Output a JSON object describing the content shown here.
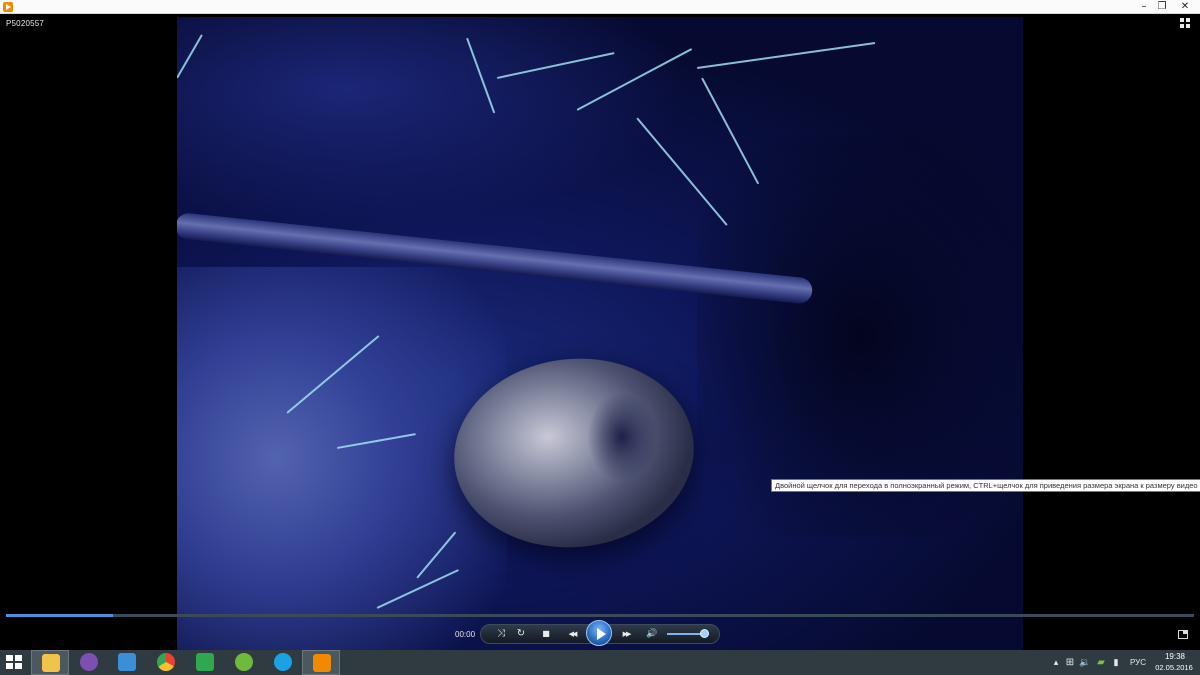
{
  "window": {
    "title_icon": "media-player-icon",
    "minimize": "–",
    "maximize": "❐",
    "close": "✕"
  },
  "file_title": "P5020557",
  "tooltip": "Двойной щелчок для перехода в полноэкранный режим, CTRL+щелчок для приведения размера экрана к размеру видео",
  "playback": {
    "time": "00:00",
    "progress_fraction": 0.09,
    "volume_fraction": 0.85,
    "buttons": {
      "shuffle": "⤨",
      "repeat": "↻",
      "stop": "■",
      "rewind": "◀◀",
      "forward": "▶▶",
      "volume": "🔊"
    }
  },
  "taskbar": {
    "apps": [
      {
        "name": "file-explorer",
        "color": "#f1c34a"
      },
      {
        "name": "viber",
        "color": "#7d4fb3"
      },
      {
        "name": "audio-app",
        "color": "#3a8fd8"
      },
      {
        "name": "chrome",
        "color": "#e84335"
      },
      {
        "name": "store",
        "color": "#2fa84f"
      },
      {
        "name": "utorrent",
        "color": "#6fb93c"
      },
      {
        "name": "skype",
        "color": "#1aa2e4"
      },
      {
        "name": "media-player",
        "color": "#f08a00"
      }
    ],
    "tray": {
      "chevron": "▴",
      "language": "РУС",
      "time": "19:38",
      "date": "02.05.2016"
    }
  }
}
